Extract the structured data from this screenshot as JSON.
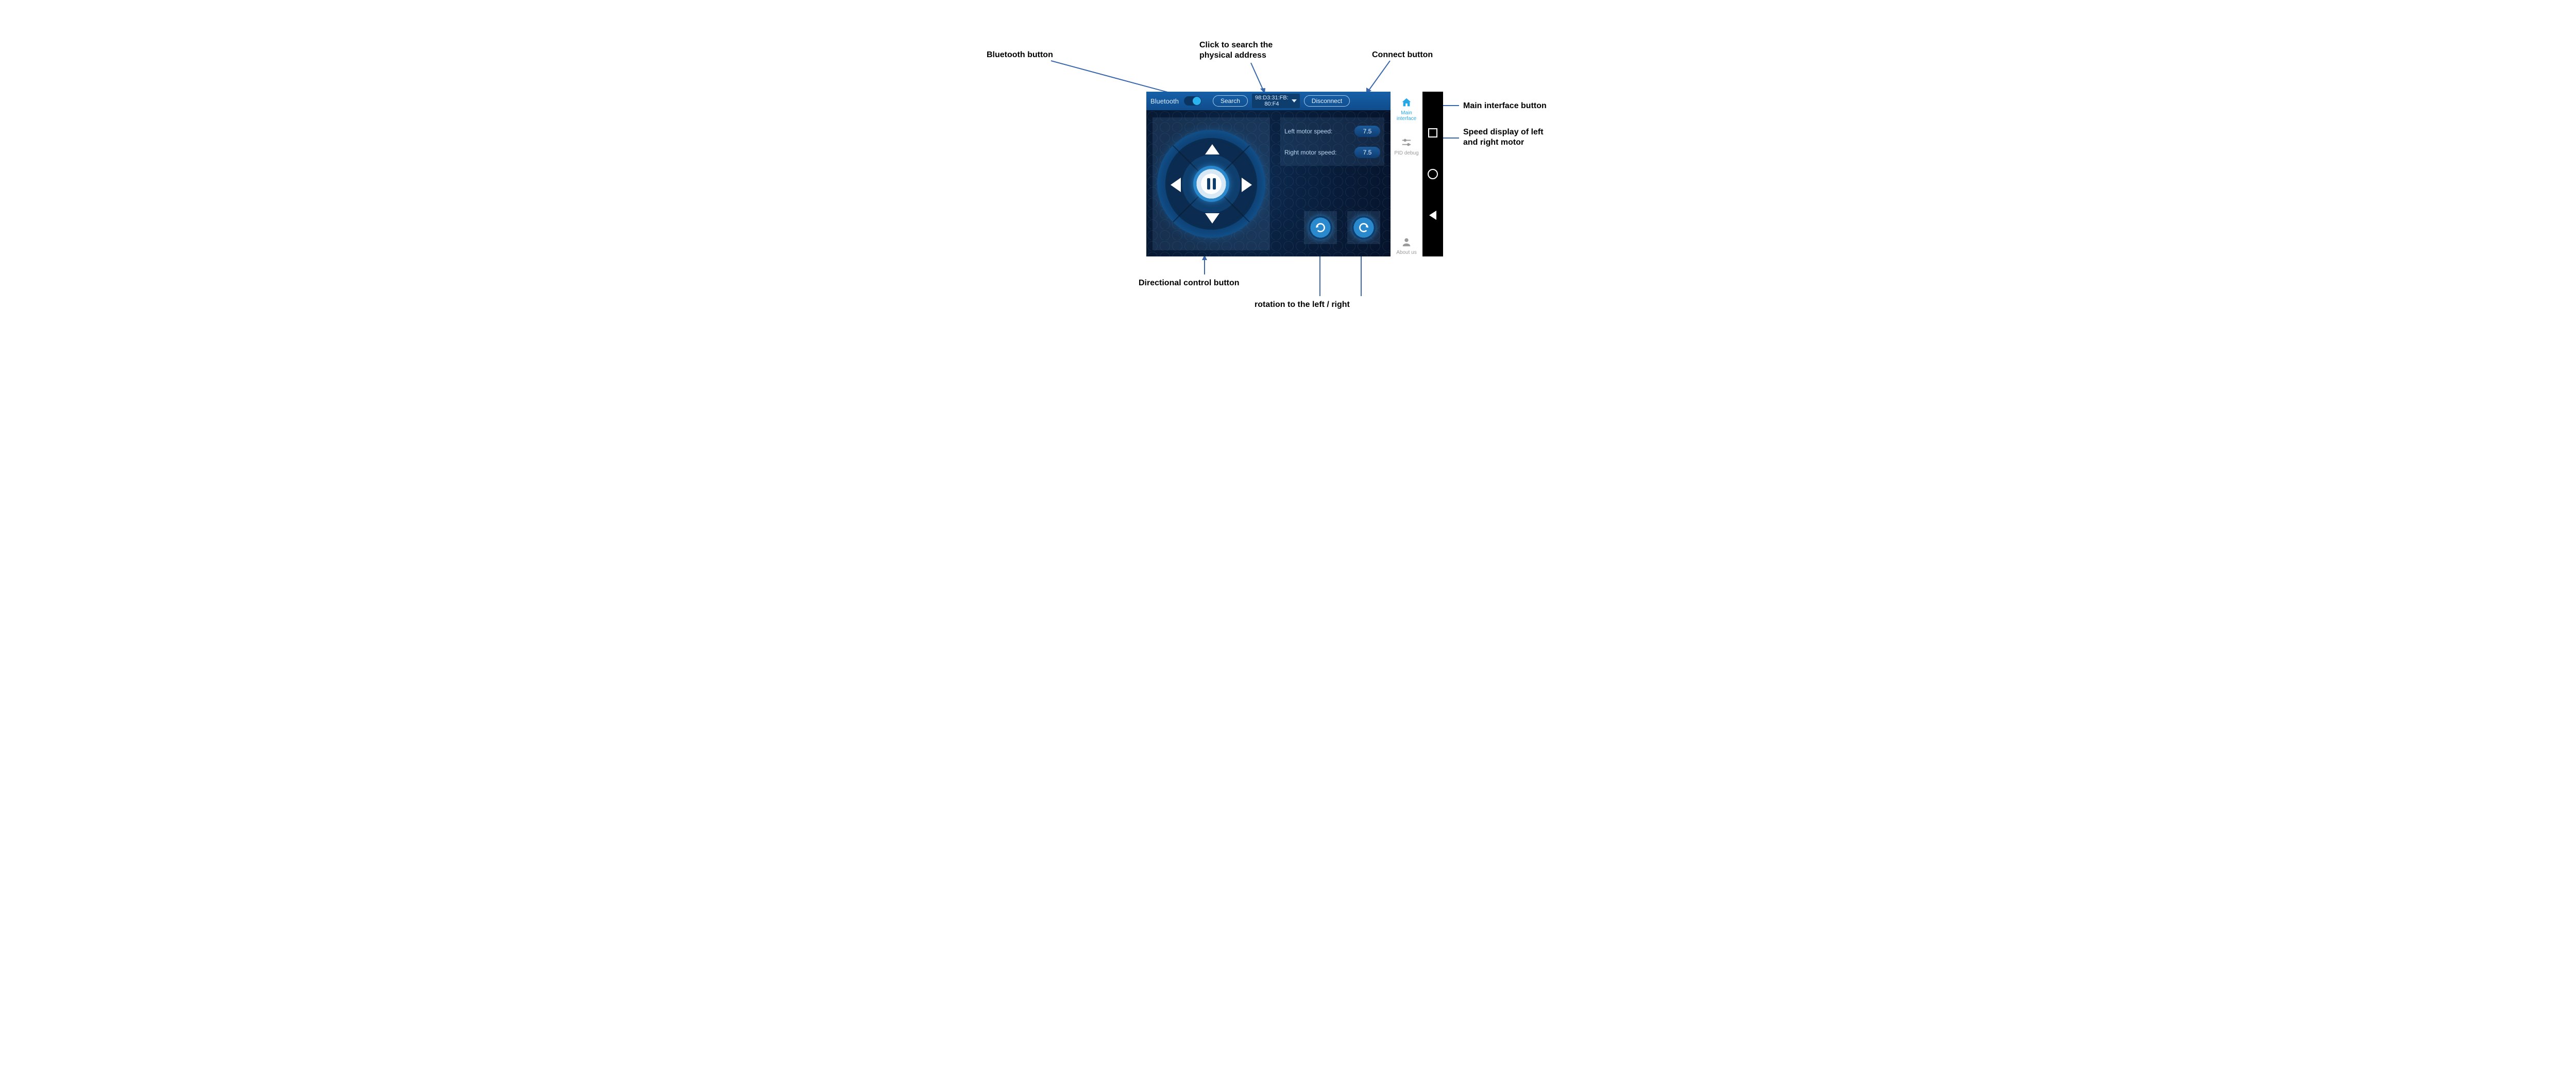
{
  "annotations": {
    "bluetooth": "Bluetooth button",
    "search": "Click to search the\nphysical address",
    "connect": "Connect button",
    "main_interface": "Main interface button",
    "speed": "Speed display of left\nand right motor",
    "dpad": "Directional control button",
    "rotation": "rotation to the left / right"
  },
  "topbar": {
    "bluetooth_label": "Bluetooth",
    "search_label": "Search",
    "address": "98:D3:31:FB:\n80:F4",
    "connect_label": "Disconnect"
  },
  "speed_panel": {
    "left_label": "Left motor speed:",
    "left_value": "7.5",
    "right_label": "Right motor speed:",
    "right_value": "7.5"
  },
  "tabs": {
    "main": "Main\ninterface",
    "pid": "PID debug",
    "about": "About us"
  }
}
